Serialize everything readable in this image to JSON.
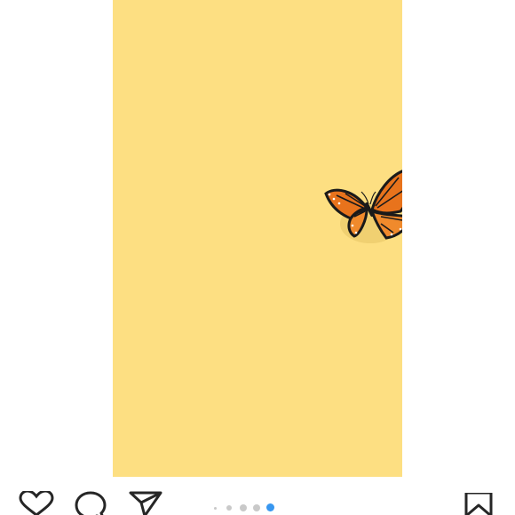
{
  "post": {
    "image_subject": "butterfly-on-yellow-background",
    "background_color": "#fddf82",
    "butterfly_color": "#e8731c"
  },
  "actions": {
    "like_icon": "heart-icon",
    "comment_icon": "comment-bubble-icon",
    "share_icon": "paper-plane-icon",
    "save_icon": "bookmark-icon"
  },
  "carousel": {
    "total_dots": 5,
    "active_index": 4,
    "active_color": "#3897f0",
    "inactive_color": "#c9c9c9"
  }
}
